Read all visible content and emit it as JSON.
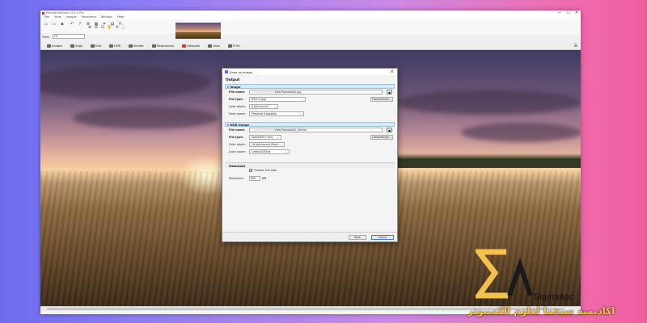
{
  "window": {
    "title": "PanoramaStudio 4.0.0 Pro",
    "controls": [
      "—",
      "☐",
      "✕"
    ]
  },
  "menubar": [
    "File",
    "View",
    "Images",
    "Panorama",
    "Window",
    "Help"
  ],
  "toolbar": {
    "view_label": "View",
    "view_value": "Fit"
  },
  "tabs": [
    "Images",
    "Align",
    "Edit",
    "HDR",
    "Render",
    "Postprocess",
    "Hotspots",
    "Save",
    "Print"
  ],
  "dialog": {
    "title": "Save as image...",
    "output_heading": "Output",
    "image_section": {
      "heading": "Image",
      "file_name_label": "File name:",
      "file_name_prefix": "C:\\Users\\Desktop\\",
      "file_name_value": "View Panorama2.jpg",
      "file_type_label": "File type:",
      "file_type_value": "JPEG (*.jpg)",
      "compression_button": "Compression...",
      "color_depth_label": "Color depth:",
      "color_depth_value": "8 bit/channel",
      "color_space_label": "Color space:",
      "color_space_value": "Preserve if possible"
    },
    "hdr_section": {
      "heading": "HDR Image",
      "file_name_label": "File name:",
      "file_name_prefix": "C:\\Users\\Desktop\\",
      "file_name_value": "View Panorama2_hdr.exr",
      "file_type_label": "File type:",
      "file_type_value": "OpenEXR (*.exr)",
      "compression_button": "Compression...",
      "color_depth_label": "Color depth:",
      "color_depth_value": "16 bit/channel (float)",
      "color_space_label": "Color space:",
      "color_space_value": "Linear ACEScg"
    },
    "metadata": {
      "heading": "Metadata",
      "transfer_exif_label": "Transfer Exif data",
      "transfer_exif_checked": true,
      "resolution_label": "Resolution:",
      "resolution_value": "300",
      "resolution_unit": "DPI"
    },
    "save_button": "Save",
    "cancel_button": "Cancel"
  },
  "watermark": {
    "brand": "Sigma4pc",
    "arabic": "اكاديمية سيجما لعلوم الكمبيوتر"
  },
  "colors": {
    "accent": "#f2c14e",
    "section_bg": "#dbe9f7"
  }
}
